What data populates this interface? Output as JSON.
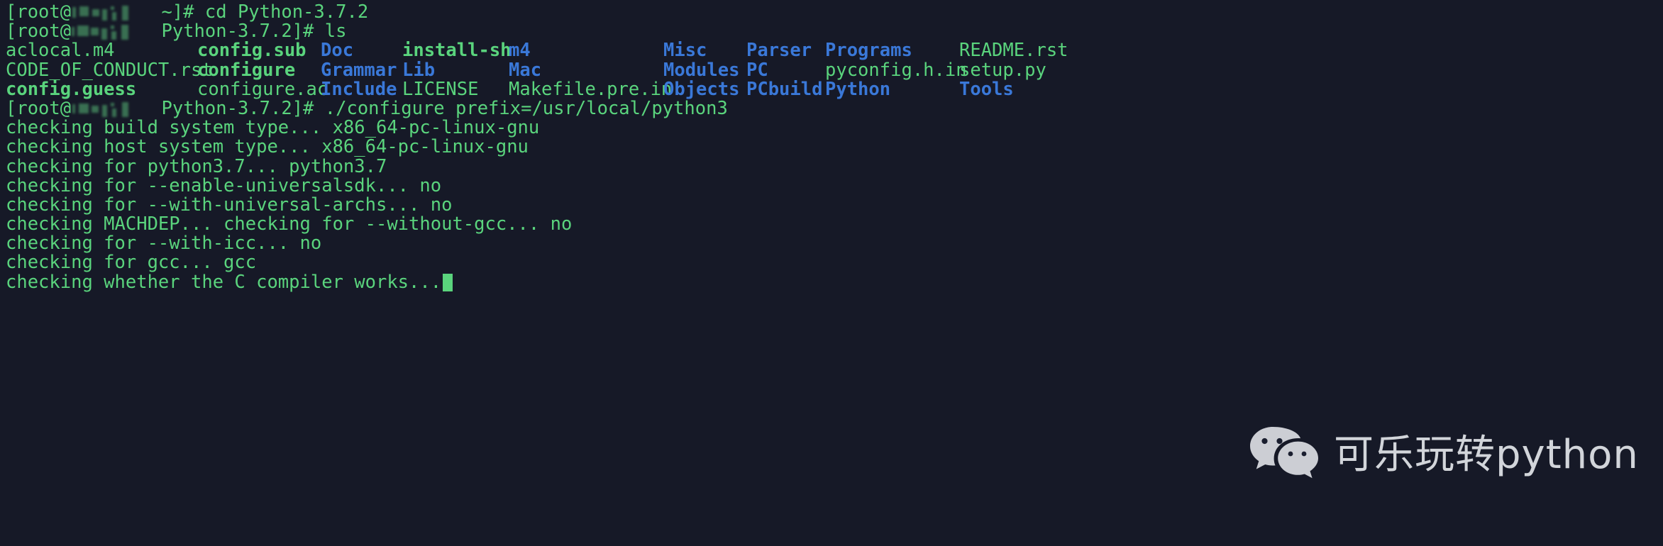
{
  "terminal": {
    "background_color": "#161927",
    "text_color": "#5ad47d",
    "dir_color": "#3a78d8",
    "exec_color": "#5ad47d",
    "lines": [
      {
        "type": "prompt",
        "prefix": "[root@",
        "host": "",
        "suffix": " ~]# ",
        "command": "cd Python-3.7.2"
      },
      {
        "type": "prompt",
        "prefix": "[root@",
        "host": "",
        "suffix": " Python-3.7.2]# ",
        "command": "ls"
      }
    ]
  },
  "prompt1": {
    "prefix": "[root@",
    "suffix": " ~]# ",
    "command": "cd Python-3.7.2"
  },
  "prompt2": {
    "prefix": "[root@",
    "suffix": " Python-3.7.2]# ",
    "command": "ls"
  },
  "prompt3": {
    "prefix": "[root@",
    "suffix": " Python-3.7.2]# ",
    "command": "./configure prefix=/usr/local/python3"
  },
  "ls_output": {
    "columns_x": [
      0,
      270,
      444,
      559,
      709,
      927,
      1044,
      1155,
      1344
    ],
    "rows": [
      [
        {
          "name": "aclocal.m4",
          "kind": "file"
        },
        {
          "name": "config.sub",
          "kind": "exec"
        },
        {
          "name": "Doc",
          "kind": "dir"
        },
        {
          "name": "install-sh",
          "kind": "exec"
        },
        {
          "name": "m4",
          "kind": "dir"
        },
        {
          "name": "Misc",
          "kind": "dir"
        },
        {
          "name": "Parser",
          "kind": "dir"
        },
        {
          "name": "Programs",
          "kind": "dir"
        },
        {
          "name": "README.rst",
          "kind": "file"
        }
      ],
      [
        {
          "name": "CODE_OF_CONDUCT.rst",
          "kind": "file"
        },
        {
          "name": "configure",
          "kind": "exec"
        },
        {
          "name": "Grammar",
          "kind": "dir"
        },
        {
          "name": "Lib",
          "kind": "dir"
        },
        {
          "name": "Mac",
          "kind": "dir"
        },
        {
          "name": "Modules",
          "kind": "dir"
        },
        {
          "name": "PC",
          "kind": "dir"
        },
        {
          "name": "pyconfig.h.in",
          "kind": "file"
        },
        {
          "name": "setup.py",
          "kind": "file"
        }
      ],
      [
        {
          "name": "config.guess",
          "kind": "exec"
        },
        {
          "name": "configure.ac",
          "kind": "file"
        },
        {
          "name": "Include",
          "kind": "dir"
        },
        {
          "name": "LICENSE",
          "kind": "file"
        },
        {
          "name": "Makefile.pre.in",
          "kind": "file"
        },
        {
          "name": "Objects",
          "kind": "dir"
        },
        {
          "name": "PCbuild",
          "kind": "dir"
        },
        {
          "name": "Python",
          "kind": "dir"
        },
        {
          "name": "Tools",
          "kind": "dir"
        }
      ]
    ]
  },
  "configure_output": [
    "checking build system type... x86_64-pc-linux-gnu",
    "checking host system type... x86_64-pc-linux-gnu",
    "checking for python3.7... python3.7",
    "checking for --enable-universalsdk... no",
    "checking for --with-universal-archs... no",
    "checking MACHDEP... checking for --without-gcc... no",
    "checking for --with-icc... no",
    "checking for gcc... gcc",
    "checking whether the C compiler works..."
  ],
  "watermark": {
    "text": "可乐玩转python",
    "icon": "wechat-icon",
    "color": "#e3e5ea"
  }
}
